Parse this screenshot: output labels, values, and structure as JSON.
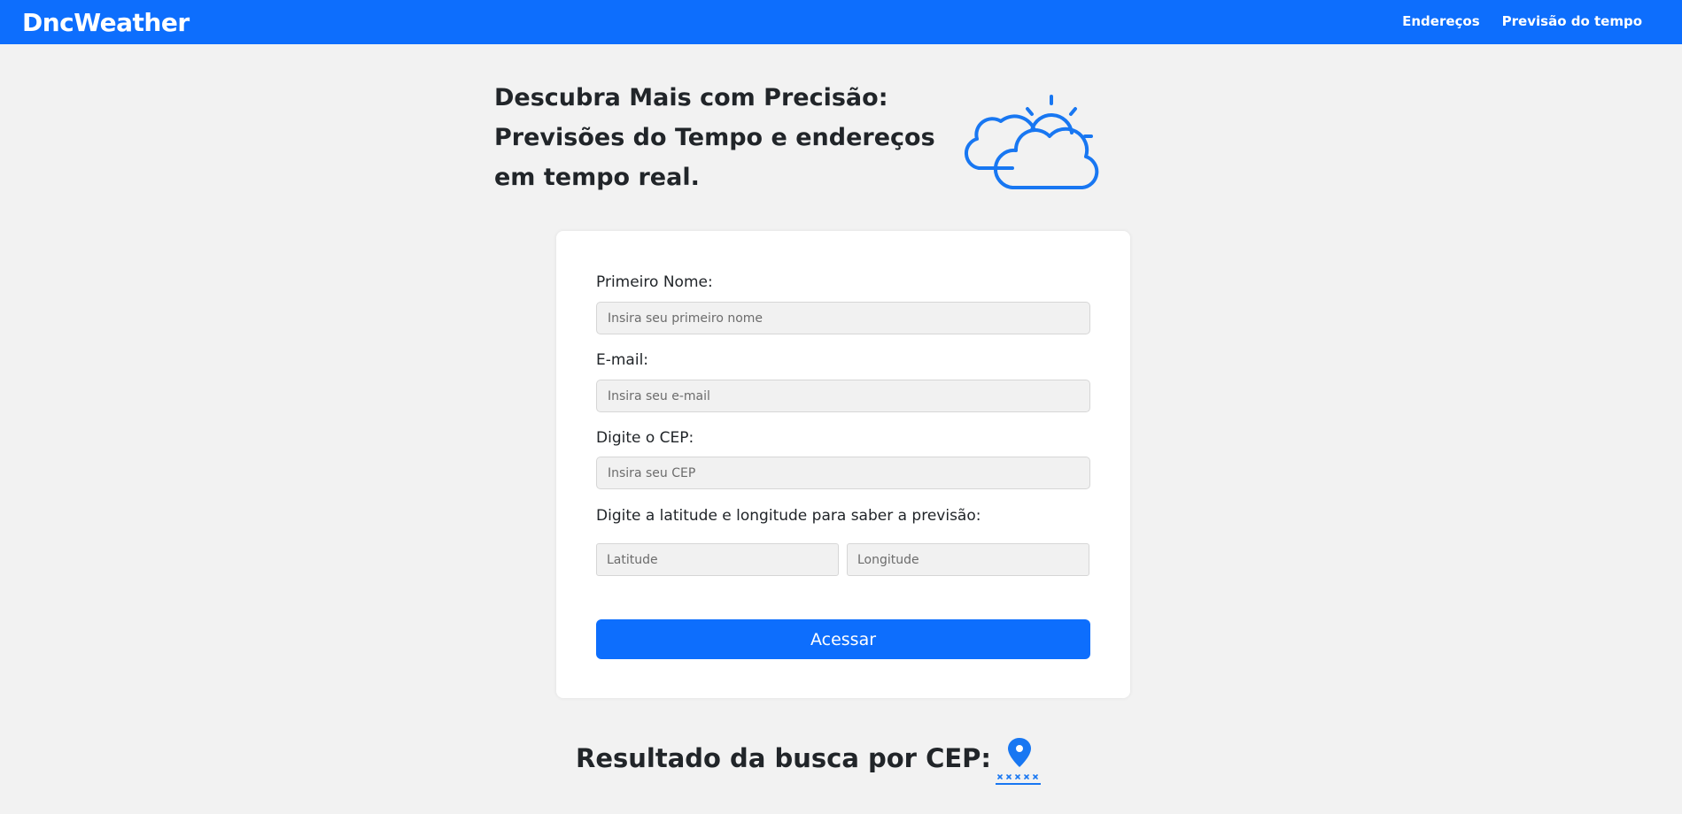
{
  "navbar": {
    "brand": "DncWeather",
    "links": [
      "Endereços",
      "Previsão do tempo"
    ],
    "color": "#0d6efd"
  },
  "hero": {
    "title": "Descubra Mais com Precisão: Previsões do Tempo e endereços em tempo real.",
    "icon": "partly-cloudy-icon"
  },
  "form": {
    "first_name": {
      "label": "Primeiro Nome:",
      "placeholder": "Insira seu primeiro nome",
      "value": ""
    },
    "email": {
      "label": "E-mail:",
      "placeholder": "Insira seu e-mail",
      "value": ""
    },
    "cep": {
      "label": "Digite o CEP:",
      "placeholder": "Insira seu CEP",
      "value": ""
    },
    "coords": {
      "label": "Digite a latitude e longitude para saber a previsão:",
      "latitude_placeholder": "Latitude",
      "longitude_placeholder": "Longitude"
    },
    "submit_label": "Acessar"
  },
  "result": {
    "title": "Resultado da busca por CEP:",
    "icon": "map-pin-icon"
  },
  "colors": {
    "accent": "#0d6efd",
    "background": "#f2f2f2",
    "card": "#ffffff",
    "text": "#212529"
  }
}
